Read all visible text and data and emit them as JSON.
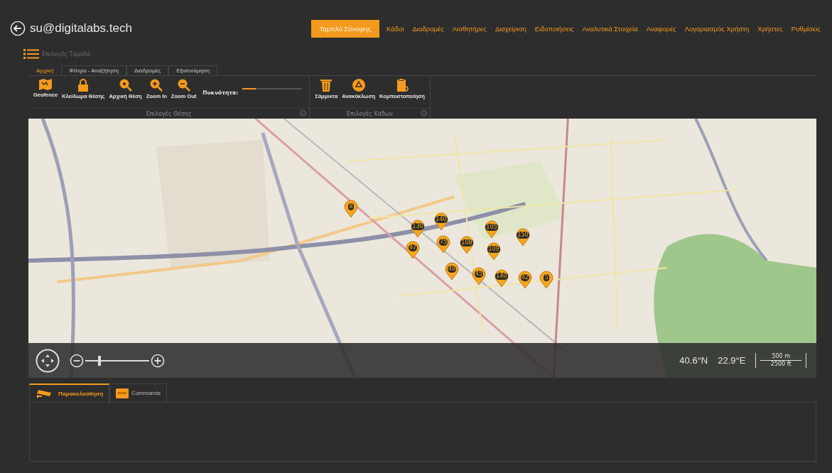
{
  "header": {
    "account": "su@digitalabs.tech"
  },
  "nav": [
    {
      "label": "Ταμπλό Σύνοψης",
      "selected": true
    },
    {
      "label": "Κάδοι",
      "selected": false
    },
    {
      "label": "Διαδρομές",
      "selected": false
    },
    {
      "label": "Αισθητήρες",
      "selected": false
    },
    {
      "label": "Διαχείριση",
      "selected": false
    },
    {
      "label": "Ειδοποιήσεις",
      "selected": false
    },
    {
      "label": "Αναλυτικά Στοιχεία",
      "selected": false
    },
    {
      "label": "Αναφορές",
      "selected": false
    },
    {
      "label": "Λογαριασμός Χρήστη",
      "selected": false
    },
    {
      "label": "Χρήστες",
      "selected": false
    },
    {
      "label": "Ρυθμίσεις",
      "selected": false
    }
  ],
  "options_panel": {
    "title": "Επιλογές Ταμπλό",
    "tabs": [
      {
        "label": "Αρχική",
        "selected": true
      },
      {
        "label": "Φίλτρο - Αναζήτηση",
        "selected": false
      },
      {
        "label": "Διαδρομές",
        "selected": false
      },
      {
        "label": "Εξισονόμηση",
        "selected": false
      }
    ],
    "groups": [
      {
        "label": "Επιλογές Θέσης",
        "buttons": [
          {
            "kind": "geofence",
            "label": "Geofence"
          },
          {
            "kind": "lock",
            "label": "Κλείδωμα Θέσης"
          },
          {
            "kind": "home",
            "label": "Αρχική Θέση"
          },
          {
            "kind": "zoomin",
            "label": "Zoom In"
          },
          {
            "kind": "zoomout",
            "label": "Zoom Out"
          }
        ],
        "density": {
          "label": "Πυκνότητα:",
          "level": 0.22
        }
      },
      {
        "label": "Επιλογές Κάδων",
        "buttons": [
          {
            "kind": "trash",
            "label": "Σύμμικτα"
          },
          {
            "kind": "recycle",
            "label": "Ανακύκλωση"
          },
          {
            "kind": "compost",
            "label": "Κομποστοποίηση"
          }
        ]
      }
    ]
  },
  "map": {
    "markers": [
      {
        "count": "8"
      },
      {
        "count": "130"
      },
      {
        "count": "140"
      },
      {
        "count": "105"
      },
      {
        "count": "150"
      },
      {
        "count": "97"
      },
      {
        "count": "75"
      },
      {
        "count": "108"
      },
      {
        "count": "109"
      },
      {
        "count": "49"
      },
      {
        "count": "45"
      },
      {
        "count": "140"
      },
      {
        "count": "42"
      },
      {
        "count": "5"
      }
    ],
    "zoom": {
      "level": 0.2
    },
    "coordinates": {
      "lat": "40.6°N",
      "lon": "22.9°E"
    },
    "scale": {
      "top": "500 m",
      "bottom": "2500 ft"
    }
  },
  "bottom_tabs": [
    {
      "kind": "camera",
      "label": "Παρακολούθηση",
      "selected": true
    },
    {
      "kind": "commands",
      "label": "Commands",
      "selected": false
    }
  ]
}
